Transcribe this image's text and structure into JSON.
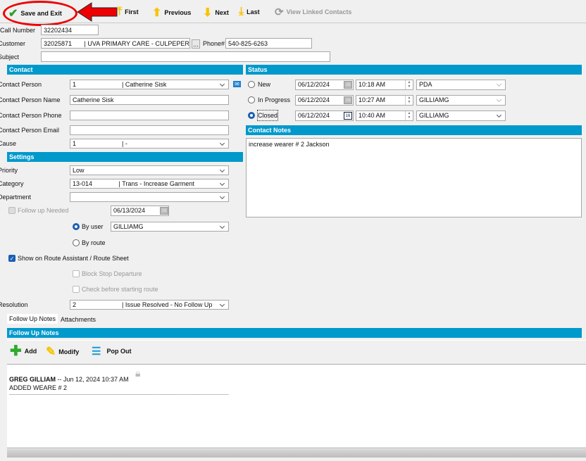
{
  "toolbar": {
    "save": "Save and Exit",
    "first": "First",
    "previous": "Previous",
    "next": "Next",
    "last": "Last",
    "linked": "View Linked Contacts"
  },
  "header": {
    "call_number_label": "Call Number",
    "call_number": "32202434",
    "customer_label": "Customer",
    "customer": "32025871       | UVA PRIMARY CARE - CULPEPER",
    "browse": "...",
    "phone_label": "Phone#",
    "phone": "540-825-6263",
    "subject_label": "Subject",
    "subject": ""
  },
  "contact": {
    "title": "Contact",
    "person_label": "Contact Person",
    "person": "1                          | Catherine Sisk",
    "name_label": "Contact Person Name",
    "name": "Catherine Sisk",
    "phone_label": "Contact Person Phone",
    "phone": "",
    "email_label": "Contact Person Email",
    "email": "",
    "cause_label": "Cause",
    "cause": "1                          | -"
  },
  "settings": {
    "title": "Settings",
    "priority_label": "Priority",
    "priority": "Low",
    "category_label": "Category",
    "category": "13-014               | Trans - Increase Garment",
    "department_label": "Department",
    "department": "",
    "follow_up_label": "Follow up Needed",
    "follow_up_date": "06/13/2024",
    "by_user_label": "By user",
    "by_user": "GILLIAMG",
    "by_route_label": "By route",
    "show_route_label": "Show on Route Assistant / Route Sheet",
    "block_stop_label": "Block Stop Departure",
    "check_before_label": "Check before starting route",
    "resolution_label": "Resolution",
    "resolution": "2                          | Issue Resolved - No Follow Up"
  },
  "status": {
    "title": "Status",
    "rows": [
      {
        "label": "New",
        "date": "06/12/2024",
        "time": "10:18 AM",
        "user": "PDA",
        "selected": false
      },
      {
        "label": "In Progress",
        "date": "06/12/2024",
        "time": "10:27 AM",
        "user": "GILLIAMG",
        "selected": false
      },
      {
        "label": "Closed",
        "date": "06/12/2024",
        "time": "10:40 AM",
        "user": "GILLIAMG",
        "selected": true
      }
    ]
  },
  "contact_notes": {
    "title": "Contact Notes",
    "text": "increase wearer # 2 Jackson"
  },
  "tabs": [
    "Follow Up Notes",
    "Attachments"
  ],
  "follow_up": {
    "title": "Follow Up Notes",
    "add": "Add",
    "modify": "Modify",
    "popout": "Pop Out",
    "author": "GREG GILLIAM",
    "date": " -- Jun 12, 2024 10:37 AM",
    "note": "ADDED WEARE # 2",
    "separator": "------------------------------------------------------------------------------------------------------------------------------------------------------------"
  },
  "calendar_glyph": "16"
}
